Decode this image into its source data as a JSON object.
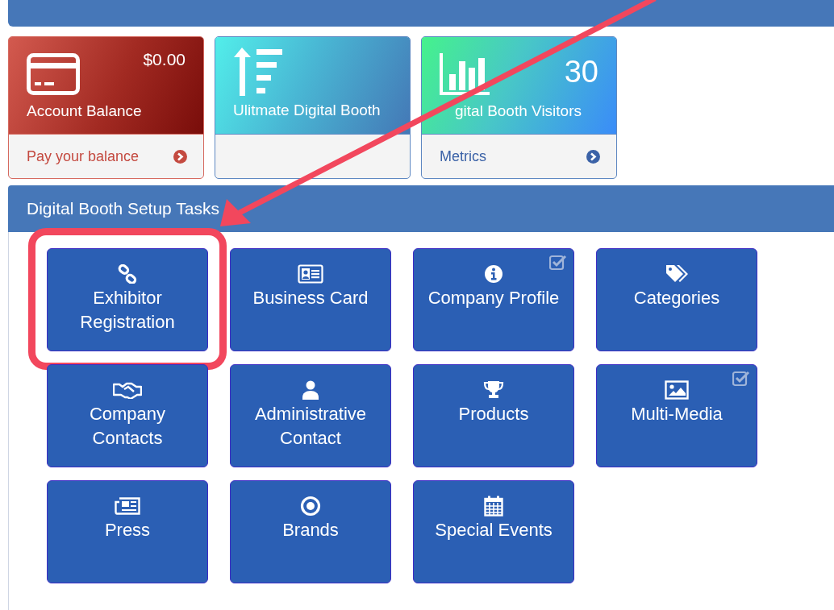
{
  "cards": [
    {
      "kind": "balance",
      "value": "$0.00",
      "label": "Account Balance",
      "link": "Pay your balance"
    },
    {
      "kind": "booth",
      "label": "Ulitmate Digital Booth"
    },
    {
      "kind": "visitors",
      "value": "30",
      "label": "gital Booth Visitors",
      "link": "Metrics"
    }
  ],
  "tasks_panel": {
    "title": "Digital Booth Setup Tasks",
    "tiles": [
      {
        "label": "Exhibitor Registration",
        "done": false,
        "highlighted": true
      },
      {
        "label": "Business Card",
        "done": false,
        "highlighted": false
      },
      {
        "label": "Company Profile",
        "done": true,
        "highlighted": false
      },
      {
        "label": "Categories",
        "done": false,
        "highlighted": false
      },
      {
        "label": "Company Contacts",
        "done": false,
        "highlighted": false
      },
      {
        "label": "Administrative Contact",
        "done": false,
        "highlighted": false
      },
      {
        "label": "Products",
        "done": false,
        "highlighted": false
      },
      {
        "label": "Multi-Media",
        "done": true,
        "highlighted": false
      },
      {
        "label": "Press",
        "done": false,
        "highlighted": false
      },
      {
        "label": "Brands",
        "done": false,
        "highlighted": false
      },
      {
        "label": "Special Events",
        "done": false,
        "highlighted": false
      }
    ]
  }
}
